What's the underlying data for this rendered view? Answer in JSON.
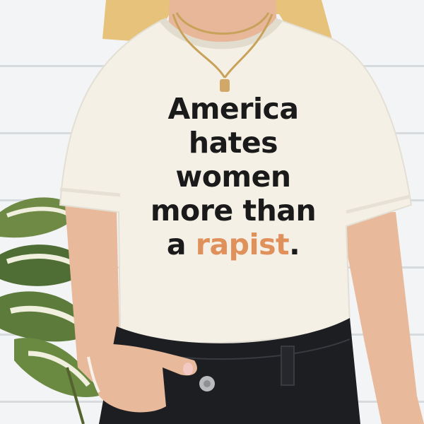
{
  "shirt": {
    "slogan": {
      "line1": "America",
      "line2": "hates",
      "line3": "women",
      "line4": "more than",
      "line5_prefix": "a ",
      "line5_accent": "rapist",
      "line5_suffix": "."
    }
  },
  "colors": {
    "text": "#1a1a1a",
    "accent": "#e0905a",
    "shirt": "#f4f0e6",
    "jeans": "#1d1e22",
    "wall": "#f3f4f5"
  }
}
